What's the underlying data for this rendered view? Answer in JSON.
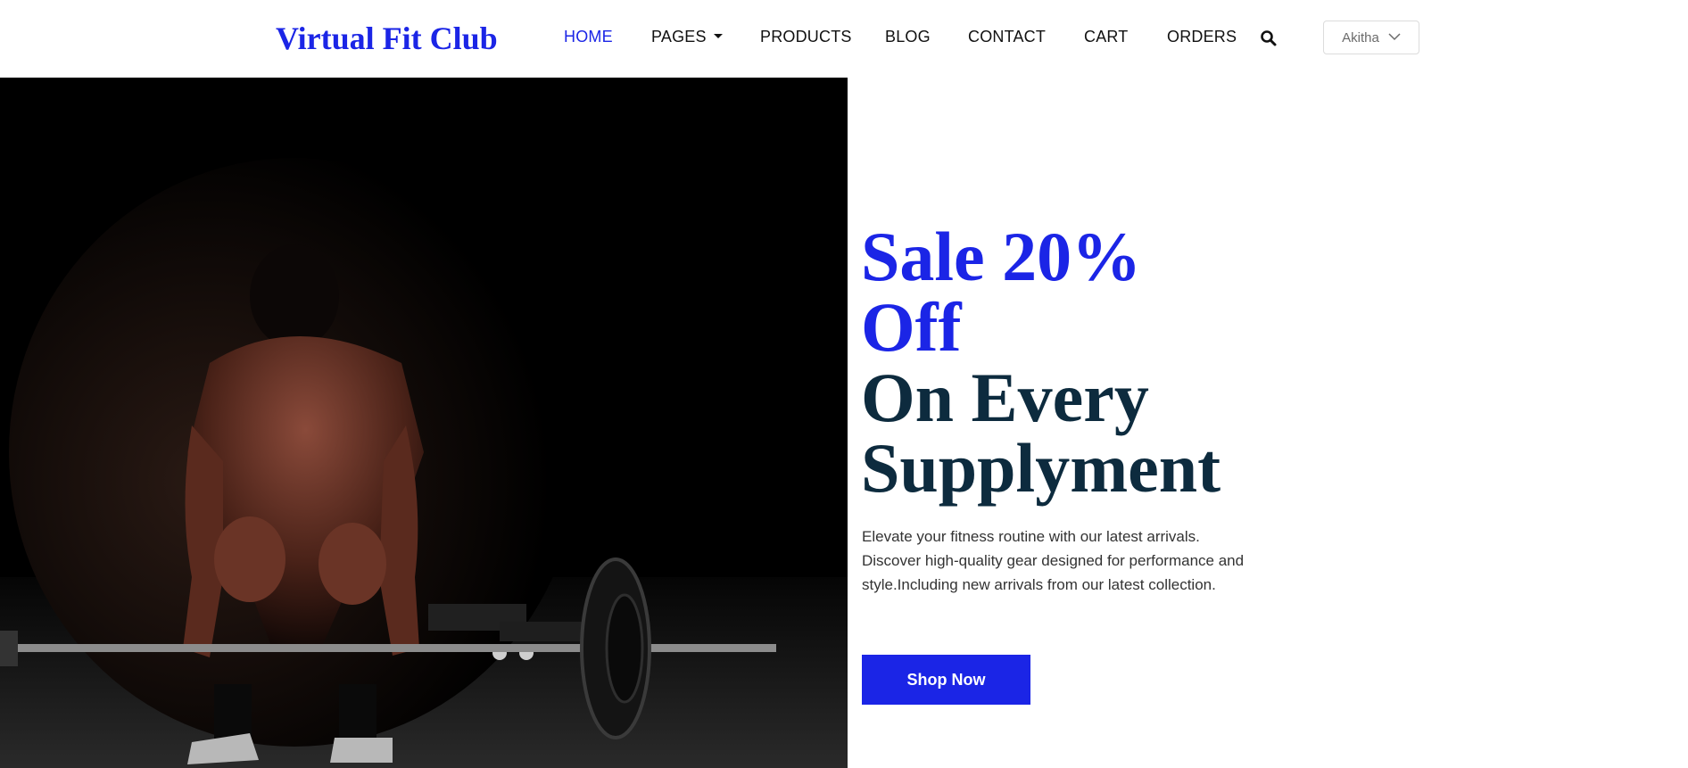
{
  "brand": {
    "name": "Virtual Fit Club"
  },
  "nav": {
    "items": [
      {
        "label": "HOME",
        "active": true
      },
      {
        "label": "PAGES",
        "has_dropdown": true
      },
      {
        "label": "PRODUCTS"
      },
      {
        "label": "BLOG"
      },
      {
        "label": "CONTACT"
      },
      {
        "label": "CART"
      },
      {
        "label": "ORDERS"
      }
    ],
    "search_icon": "search-icon"
  },
  "user_menu": {
    "name": "Akitha",
    "icon": "chevron-down-icon"
  },
  "hero": {
    "headline_line1": "Sale 20%",
    "headline_line2": "Off",
    "headline_line3": "On Every",
    "headline_line4": "Supplyment",
    "description": "Elevate your fitness routine with our latest arrivals. Discover high-quality gear designed for performance and style.Including new arrivals from our latest collection.",
    "cta_label": "Shop Now"
  },
  "colors": {
    "accent": "#1b25e6",
    "headline_dark": "#0d2b3e",
    "text": "#333333",
    "image_background": "#000000"
  }
}
